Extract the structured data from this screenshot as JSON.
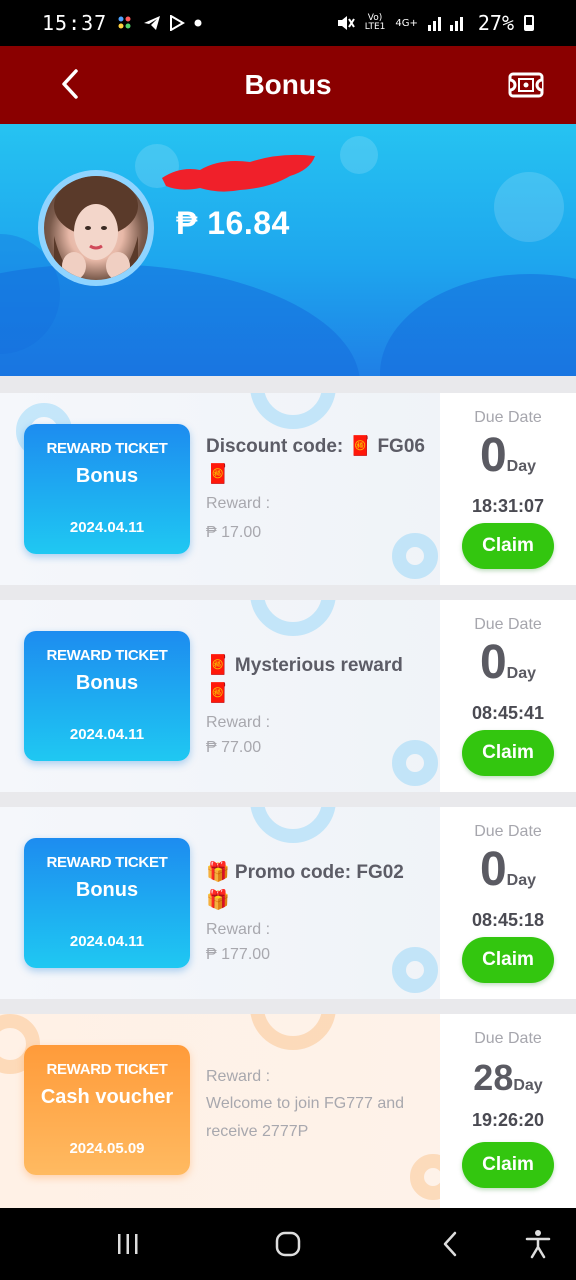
{
  "status_bar": {
    "time": "15:37",
    "battery": "27%",
    "network": "4G+",
    "left_icons": [
      "photos-icon",
      "telegram-icon",
      "play-icon",
      "dot-icon"
    ],
    "right_icons": [
      "mute-icon",
      "volte-icon",
      "signal-icon",
      "battery-icon"
    ]
  },
  "header": {
    "title": "Bonus",
    "back_icon": "chevron-left-icon",
    "right_icon": "ticket-icon",
    "bg_color": "#8a0000"
  },
  "profile": {
    "balance": "₱ 16.84"
  },
  "labels": {
    "due_date": "Due Date",
    "day_unit": "Day",
    "claim": "Claim",
    "reward": "Reward :"
  },
  "tickets": [
    {
      "ticket_title": "REWARD TICKET",
      "ticket_name": "Bonus",
      "ticket_date": "2024.04.11",
      "name": "Discount code: 🧧 FG06 🧧",
      "reward_value": "₱ 17.00",
      "days": "0",
      "time": "18:31:07"
    },
    {
      "ticket_title": "REWARD TICKET",
      "ticket_name": "Bonus",
      "ticket_date": "2024.04.11",
      "name": "🧧 Mysterious reward 🧧",
      "reward_value": "₱ 77.00",
      "days": "0",
      "time": "08:45:41"
    },
    {
      "ticket_title": "REWARD TICKET",
      "ticket_name": "Bonus",
      "ticket_date": "2024.04.11",
      "name": "🎁 Promo code: FG02 🎁",
      "reward_value": "₱ 177.00",
      "days": "0",
      "time": "08:45:18"
    },
    {
      "ticket_title": "REWARD TICKET",
      "ticket_name": "Cash voucher",
      "ticket_date": "2024.05.09",
      "reward_value": "Welcome to join FG777 and receive 2777P",
      "days": "28",
      "time": "19:26:20"
    }
  ],
  "colors": {
    "claim_green": "#33c60f",
    "ticket_blue": "#1d8cf0",
    "ticket_orange": "#ff9b3a"
  },
  "navbar": {
    "icons": [
      "recent-apps-icon",
      "home-icon",
      "back-icon",
      "accessibility-icon"
    ]
  }
}
